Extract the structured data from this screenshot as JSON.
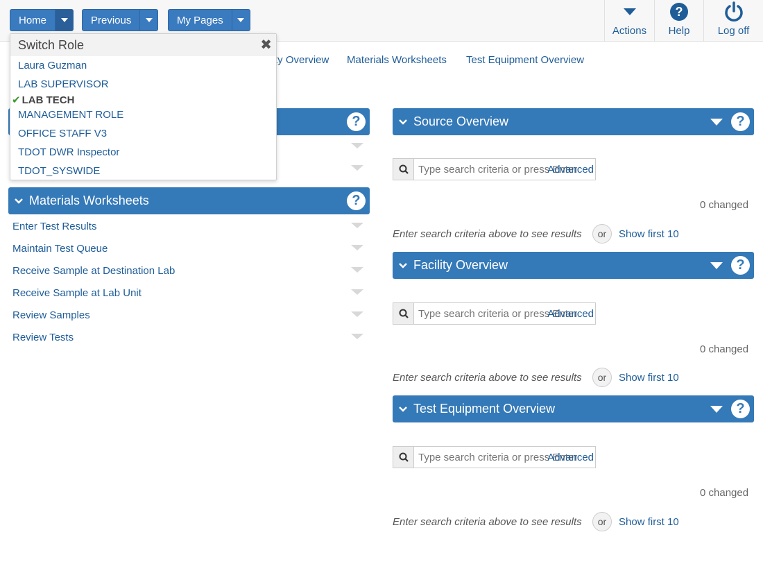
{
  "nav": {
    "home": "Home",
    "previous": "Previous",
    "my_pages": "My Pages"
  },
  "tools": {
    "actions": "Actions",
    "help": "Help",
    "logoff": "Log off"
  },
  "links": {
    "partial_overview": "ty Overview",
    "materials_worksheets": "Materials Worksheets",
    "test_equipment_overview": "Test Equipment Overview"
  },
  "switch_role": {
    "title": "Switch Role",
    "items": [
      "Laura Guzman",
      "LAB SUPERVISOR",
      "LAB TECH",
      "MANAGEMENT ROLE",
      "OFFICE STAFF V3",
      "TDOT DWR Inspector",
      "TDOT_SYSWIDE"
    ],
    "active_index": 2
  },
  "materials_worksheets": {
    "title": "Materials Worksheets",
    "items": [
      "Enter Test Results",
      "Maintain Test Queue",
      "Receive Sample at Destination Lab",
      "Receive Sample at Lab Unit",
      "Review Samples",
      "Review Tests"
    ]
  },
  "overviews": [
    {
      "title": "Source Overview",
      "search_placeholder": "Type search criteria or press Enter",
      "advanced": "Advanced",
      "changed": "0 changed",
      "hint": "Enter search criteria above to see results",
      "or": "or",
      "show_first": "Show first 10"
    },
    {
      "title": "Facility Overview",
      "search_placeholder": "Type search criteria or press Enter",
      "advanced": "Advanced",
      "changed": "0 changed",
      "hint": "Enter search criteria above to see results",
      "or": "or",
      "show_first": "Show first 10"
    },
    {
      "title": "Test Equipment Overview",
      "search_placeholder": "Type search criteria or press Enter",
      "advanced": "Advanced",
      "changed": "0 changed",
      "hint": "Enter search criteria above to see results",
      "or": "or",
      "show_first": "Show first 10"
    }
  ],
  "colors": {
    "primary": "#3479b8",
    "link": "#1f5d99",
    "check": "#3a9a2a"
  }
}
